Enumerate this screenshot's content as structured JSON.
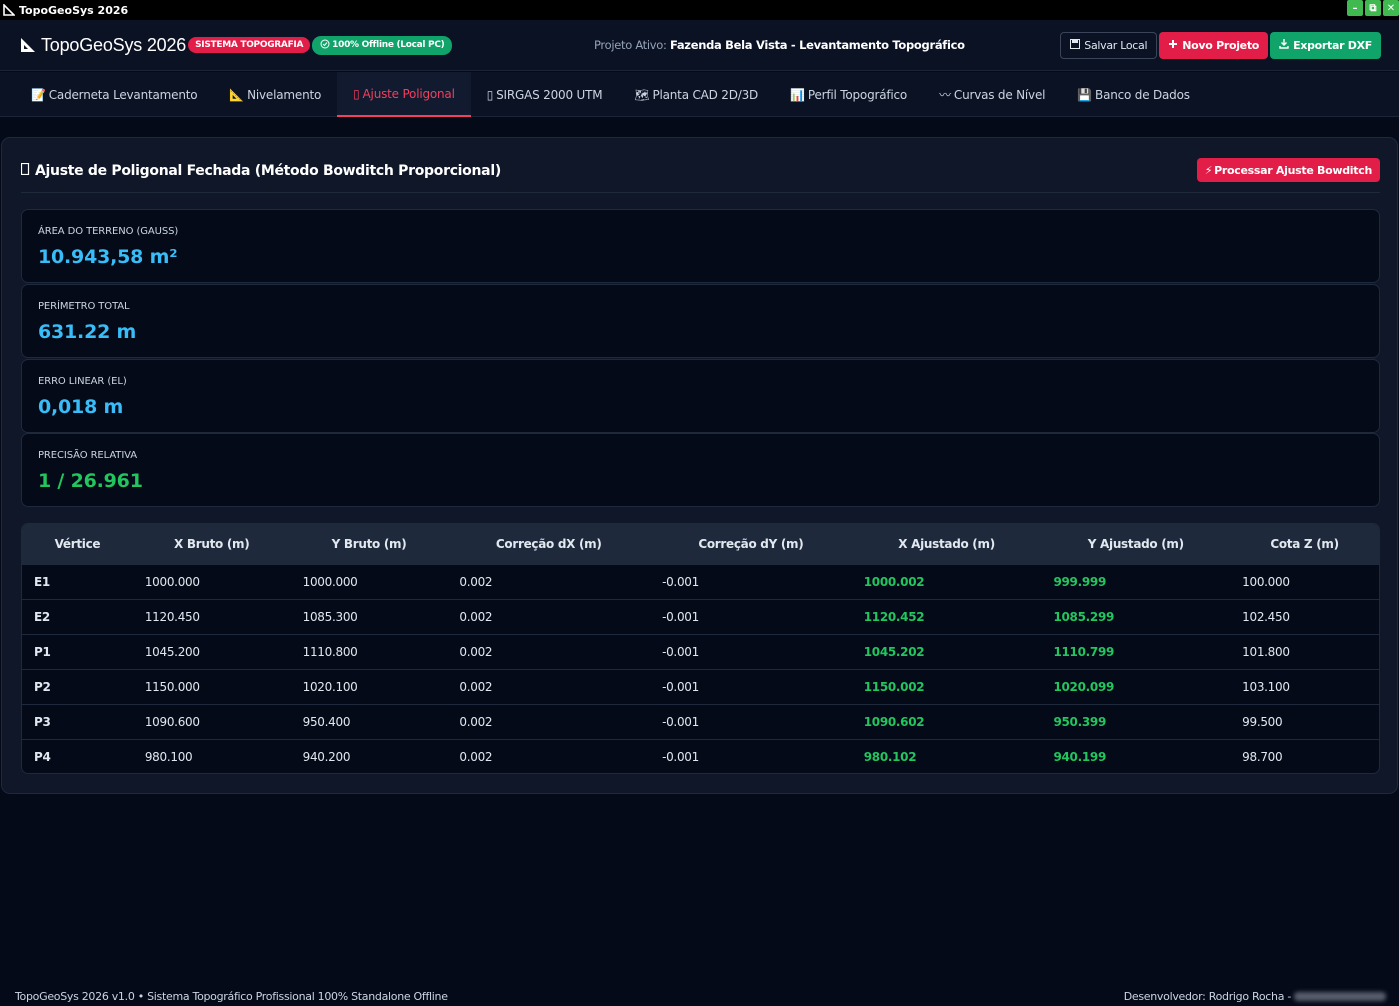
{
  "window": {
    "title": "TopoGeoSys 2026",
    "controls": {
      "minimize": "–",
      "maximize": "⧉",
      "close": "✕"
    }
  },
  "header": {
    "brand": "TopoGeoSys 2026",
    "badge_system": "SISTEMA TOPOGRAFIA",
    "badge_offline": "100% Offline (Local PC)",
    "project_label": "Projeto Ativo:",
    "project_name": "Fazenda Bela Vista - Levantamento Topográfico",
    "actions": {
      "save": "Salvar Local",
      "new": "Novo Projeto",
      "export": "Exportar DXF"
    }
  },
  "tabs": [
    {
      "label": "Caderneta Levantamento",
      "icon": "📝"
    },
    {
      "label": "Nivelamento",
      "icon": "📐"
    },
    {
      "label": "Ajuste Poligonal",
      "icon": "▯"
    },
    {
      "label": "SIRGAS 2000 UTM",
      "icon": "▯"
    },
    {
      "label": "Planta CAD 2D/3D",
      "icon": "🗺"
    },
    {
      "label": "Perfil Topográfico",
      "icon": "📊"
    },
    {
      "label": "Curvas de Nível",
      "icon": "〰"
    },
    {
      "label": "Banco de Dados",
      "icon": "💾"
    }
  ],
  "active_tab": "Ajuste Poligonal",
  "panel": {
    "title": "Ajuste de Poligonal Fechada (Método Bowditch Proporcional)",
    "process_button": "Processar Ajuste Bowditch",
    "stats": [
      {
        "label": "ÁREA DO TERRENO (GAUSS)",
        "value": "10.943,58 m²"
      },
      {
        "label": "PERÍMETRO TOTAL",
        "value": "631.22 m"
      },
      {
        "label": "ERRO LINEAR (EL)",
        "value": "0,018 m"
      },
      {
        "label": "PRECISÃO RELATIVA",
        "value": "1 / 26.961"
      }
    ],
    "table": {
      "headers": [
        "Vértice",
        "X Bruto (m)",
        "Y Bruto (m)",
        "Correção dX (m)",
        "Correção dY (m)",
        "X Ajustado (m)",
        "Y Ajustado (m)",
        "Cota Z (m)"
      ],
      "rows": [
        [
          "E1",
          "1000.000",
          "1000.000",
          "0.002",
          "-0.001",
          "1000.002",
          "999.999",
          "100.000"
        ],
        [
          "E2",
          "1120.450",
          "1085.300",
          "0.002",
          "-0.001",
          "1120.452",
          "1085.299",
          "102.450"
        ],
        [
          "P1",
          "1045.200",
          "1110.800",
          "0.002",
          "-0.001",
          "1045.202",
          "1110.799",
          "101.800"
        ],
        [
          "P2",
          "1150.000",
          "1020.100",
          "0.002",
          "-0.001",
          "1150.002",
          "1020.099",
          "103.100"
        ],
        [
          "P3",
          "1090.600",
          "950.400",
          "0.002",
          "-0.001",
          "1090.602",
          "950.399",
          "99.500"
        ],
        [
          "P4",
          "980.100",
          "940.200",
          "0.002",
          "-0.001",
          "980.102",
          "940.199",
          "98.700"
        ]
      ]
    }
  },
  "footer": {
    "left": "TopoGeoSys 2026 v1.0 • Sistema Topográfico Profissional 100% Standalone Offline",
    "right": "Desenvolvedor: Rodrigo Rocha -"
  },
  "colors": {
    "accent_red": "#e11d48",
    "accent_green": "#10a36a",
    "value_blue": "#38bdf8",
    "value_green": "#22c55e"
  }
}
